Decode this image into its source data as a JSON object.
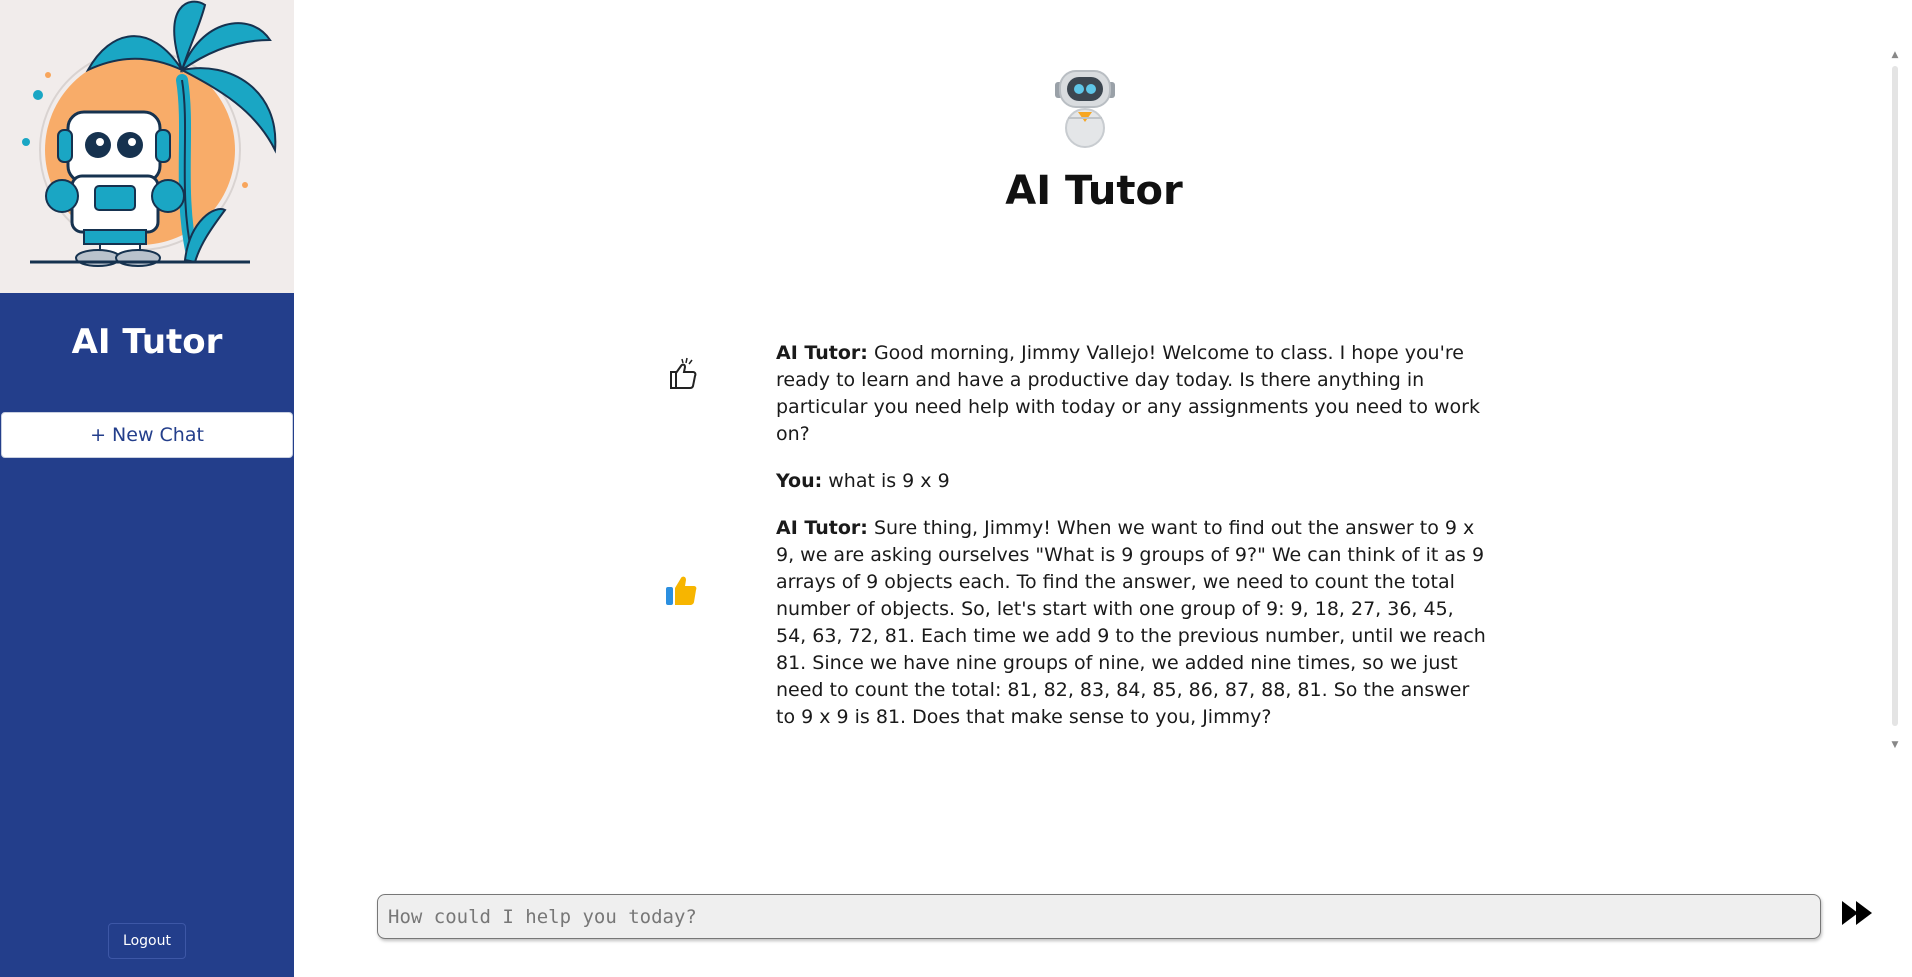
{
  "sidebar": {
    "title": "AI Tutor",
    "new_chat_label": "+ New Chat",
    "logout_label": "Logout",
    "bg_color": "#233e8b"
  },
  "main": {
    "title": "AI Tutor"
  },
  "messages": [
    {
      "speaker": "AI Tutor:",
      "text": " Good morning, Jimmy Vallejo! Welcome to class. I hope you're ready to learn and have a productive day today. Is there anything in particular you need help with today or any assignments you need to work on?",
      "feedback_icon": "thumbs-up-outline-icon"
    },
    {
      "speaker": "You:",
      "text": " what is 9 x 9"
    },
    {
      "speaker": "AI Tutor:",
      "text": " Sure thing, Jimmy! When we want to find out the answer to 9 x 9, we are asking ourselves \"What is 9 groups of 9?\" We can think of it as 9 arrays of 9 objects each. To find the answer, we need to count the total number of objects. So, let's start with one group of 9: 9, 18, 27, 36, 45, 54, 63, 72, 81. Each time we add 9 to the previous number, until we reach 81. Since we have nine groups of nine, we added nine times, so we just need to count the total: 81, 82, 83, 84, 85, 86, 87, 88, 81. So the answer to 9 x 9 is 81. Does that make sense to you, Jimmy?",
      "feedback_icon": "thumbs-up-filled-icon"
    }
  ],
  "input": {
    "placeholder": "How could I help you today?"
  },
  "icons": {
    "hero": "robot-palm-illustration",
    "header": "robot-avatar-icon",
    "send": "fast-forward-send-icon"
  }
}
